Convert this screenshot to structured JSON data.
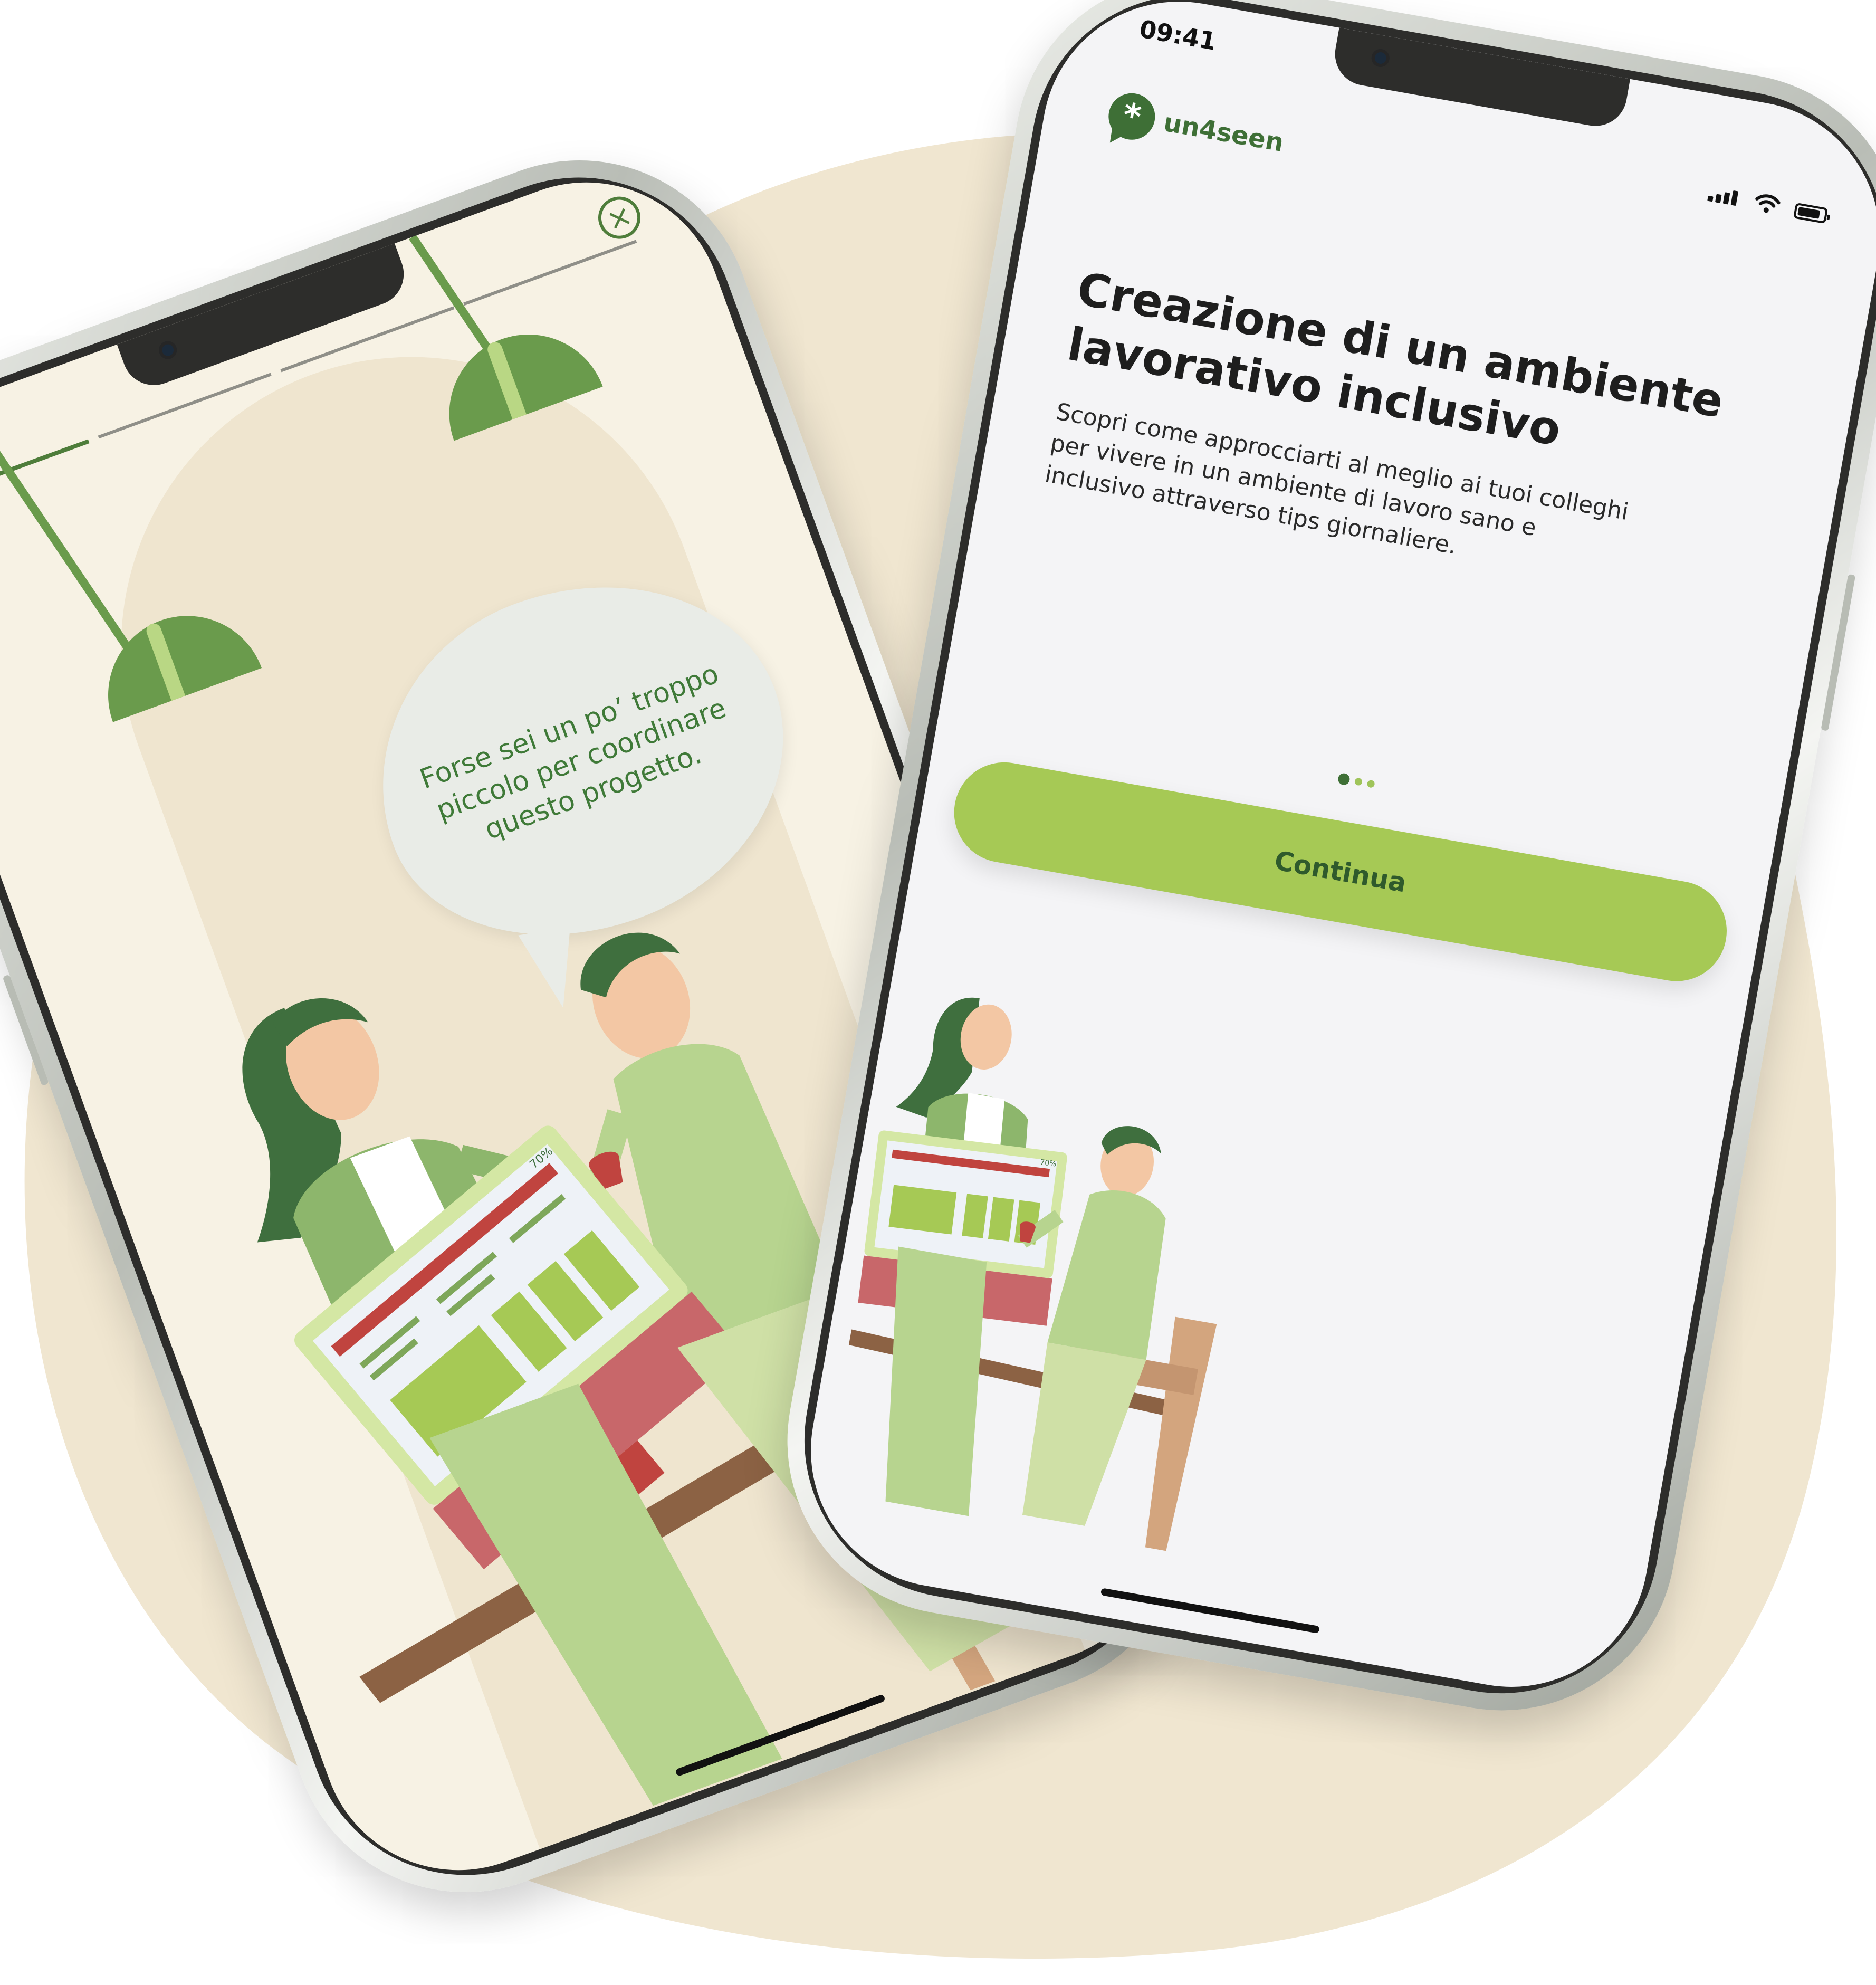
{
  "colors": {
    "background_blob": "#f0e6d0",
    "brand_green_dark": "#3e6f36",
    "brand_green_light": "#a6c955",
    "left_screen_bg": "#f7f2e4",
    "right_screen_bg": "#f4f4f6"
  },
  "left_phone": {
    "progress": {
      "segments": 4,
      "active_index": 0
    },
    "close_icon": "close-circle-icon",
    "speech_bubble": {
      "text": "Forse sei un po’ troppo piccolo per coordinare questo progetto."
    },
    "illustration": {
      "monitor_progress_label": "70%"
    }
  },
  "right_phone": {
    "status_bar": {
      "time": "09:41"
    },
    "brand": {
      "logo_icon": "asterisk-chat-icon",
      "name": "un4seen"
    },
    "title": "Creazione di un ambiente lavorativo inclusivo",
    "description": "Scopri come approcciarti al meglio ai tuoi colleghi per vivere in un ambiente di lavoro sano e inclusivo attraverso tips giornaliere.",
    "pagination": {
      "total": 3,
      "active_index": 0
    },
    "cta_label": "Continua",
    "illustration": {
      "monitor_progress_label": "70%"
    }
  }
}
